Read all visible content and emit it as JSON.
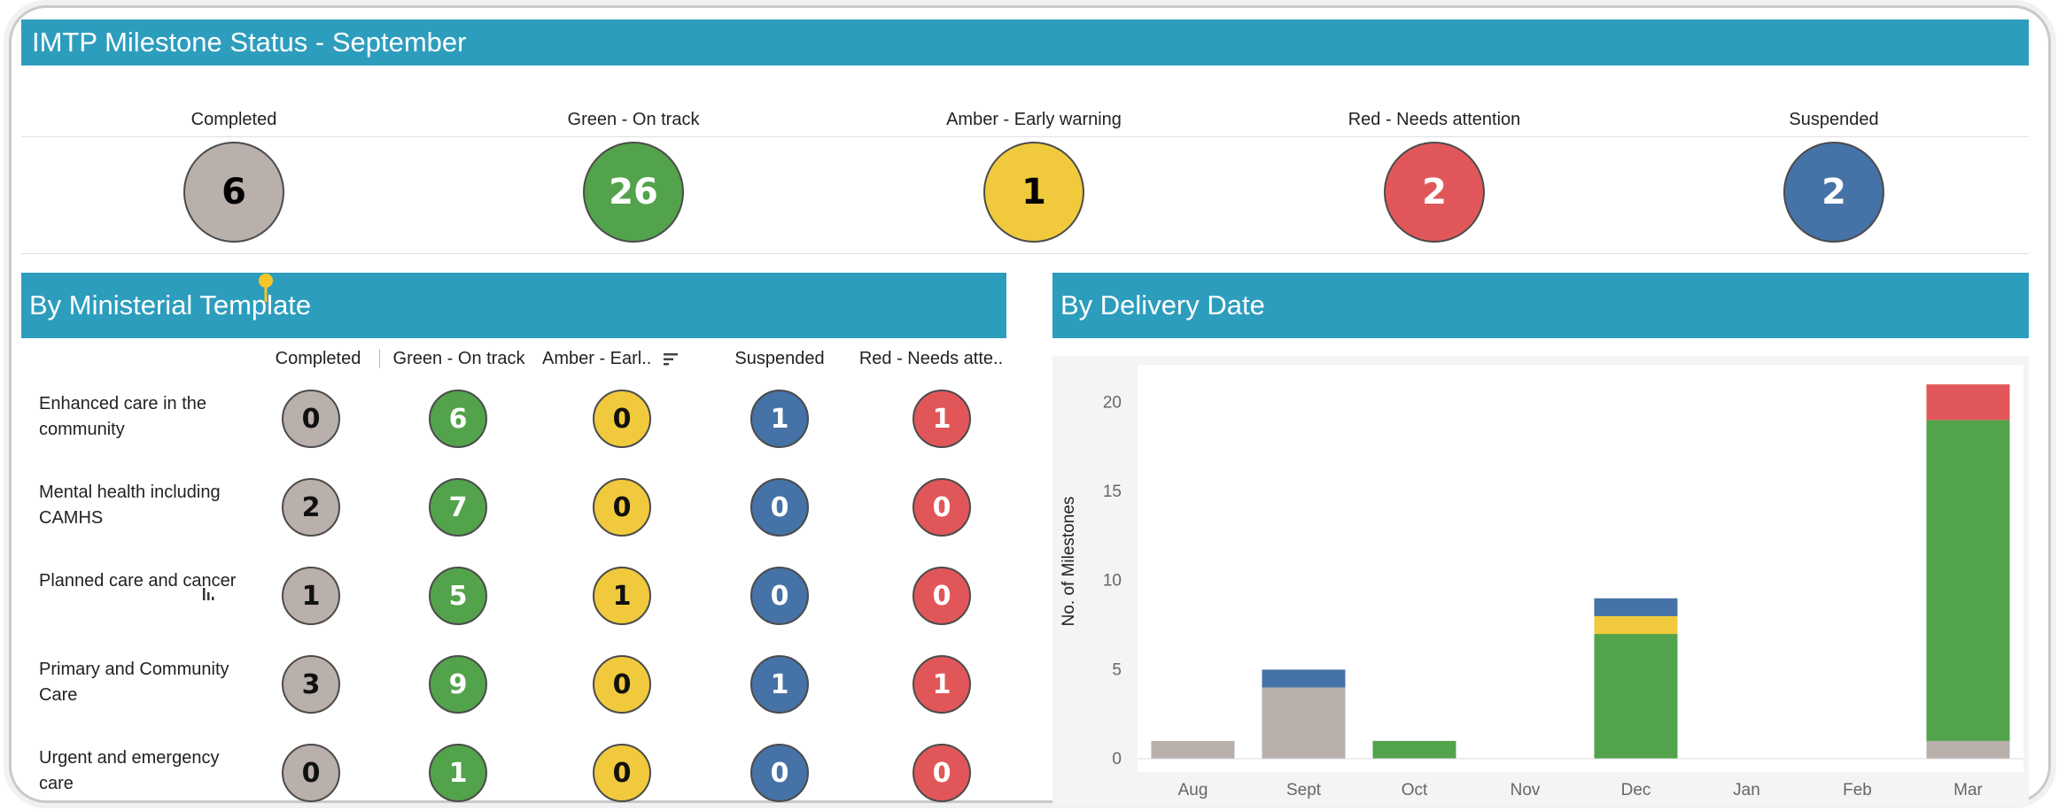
{
  "title": "IMTP Milestone Status - September",
  "colors": {
    "completed": "#b9afab",
    "green": "#52a34b",
    "amber": "#f0ca3c",
    "suspended": "#4572a7",
    "red": "#e15759",
    "header": "#2d9dbd"
  },
  "kpis": [
    {
      "label": "Completed",
      "value": "6"
    },
    {
      "label": "Green - On track",
      "value": "26"
    },
    {
      "label": "Amber - Early warning",
      "value": "1"
    },
    {
      "label": "Red - Needs attention",
      "value": "2"
    },
    {
      "label": "Suspended",
      "value": "2"
    }
  ],
  "ministerial": {
    "heading": "By Ministerial Template",
    "columns": [
      "Completed",
      "Green - On track",
      "Amber - Earl..",
      "Suspended",
      "Red - Needs atte.."
    ],
    "rows": [
      {
        "label": "Enhanced care in the community",
        "values": [
          "0",
          "6",
          "0",
          "1",
          "1"
        ]
      },
      {
        "label": "Mental health including CAMHS",
        "values": [
          "2",
          "7",
          "0",
          "0",
          "0"
        ]
      },
      {
        "label": "Planned care and cancer",
        "values": [
          "1",
          "5",
          "1",
          "0",
          "0"
        ]
      },
      {
        "label": "Primary and Community Care",
        "values": [
          "3",
          "9",
          "0",
          "1",
          "1"
        ]
      },
      {
        "label": "Urgent and emergency care",
        "values": [
          "0",
          "1",
          "0",
          "0",
          "0"
        ]
      }
    ]
  },
  "delivery": {
    "heading": "By Delivery Date"
  },
  "chart_data": {
    "type": "bar",
    "stacked": true,
    "categories": [
      "Aug",
      "Sept",
      "Oct",
      "Nov",
      "Dec",
      "Jan",
      "Feb",
      "Mar"
    ],
    "series": [
      {
        "name": "Completed",
        "color": "#b9afab",
        "values": [
          1,
          4,
          0,
          0,
          0,
          0,
          0,
          1
        ]
      },
      {
        "name": "Green - On track",
        "color": "#52a34b",
        "values": [
          0,
          0,
          1,
          0,
          7,
          0,
          0,
          18
        ]
      },
      {
        "name": "Amber - Early warning",
        "color": "#f0ca3c",
        "values": [
          0,
          0,
          0,
          0,
          1,
          0,
          0,
          0
        ]
      },
      {
        "name": "Suspended",
        "color": "#4572a7",
        "values": [
          0,
          1,
          0,
          0,
          1,
          0,
          0,
          0
        ]
      },
      {
        "name": "Red - Needs attention",
        "color": "#e15759",
        "values": [
          0,
          0,
          0,
          0,
          0,
          0,
          0,
          2
        ]
      }
    ],
    "ylabel": "No. of Milestones",
    "ylim": [
      0,
      22
    ],
    "yticks": [
      0,
      5,
      10,
      15,
      20
    ]
  }
}
